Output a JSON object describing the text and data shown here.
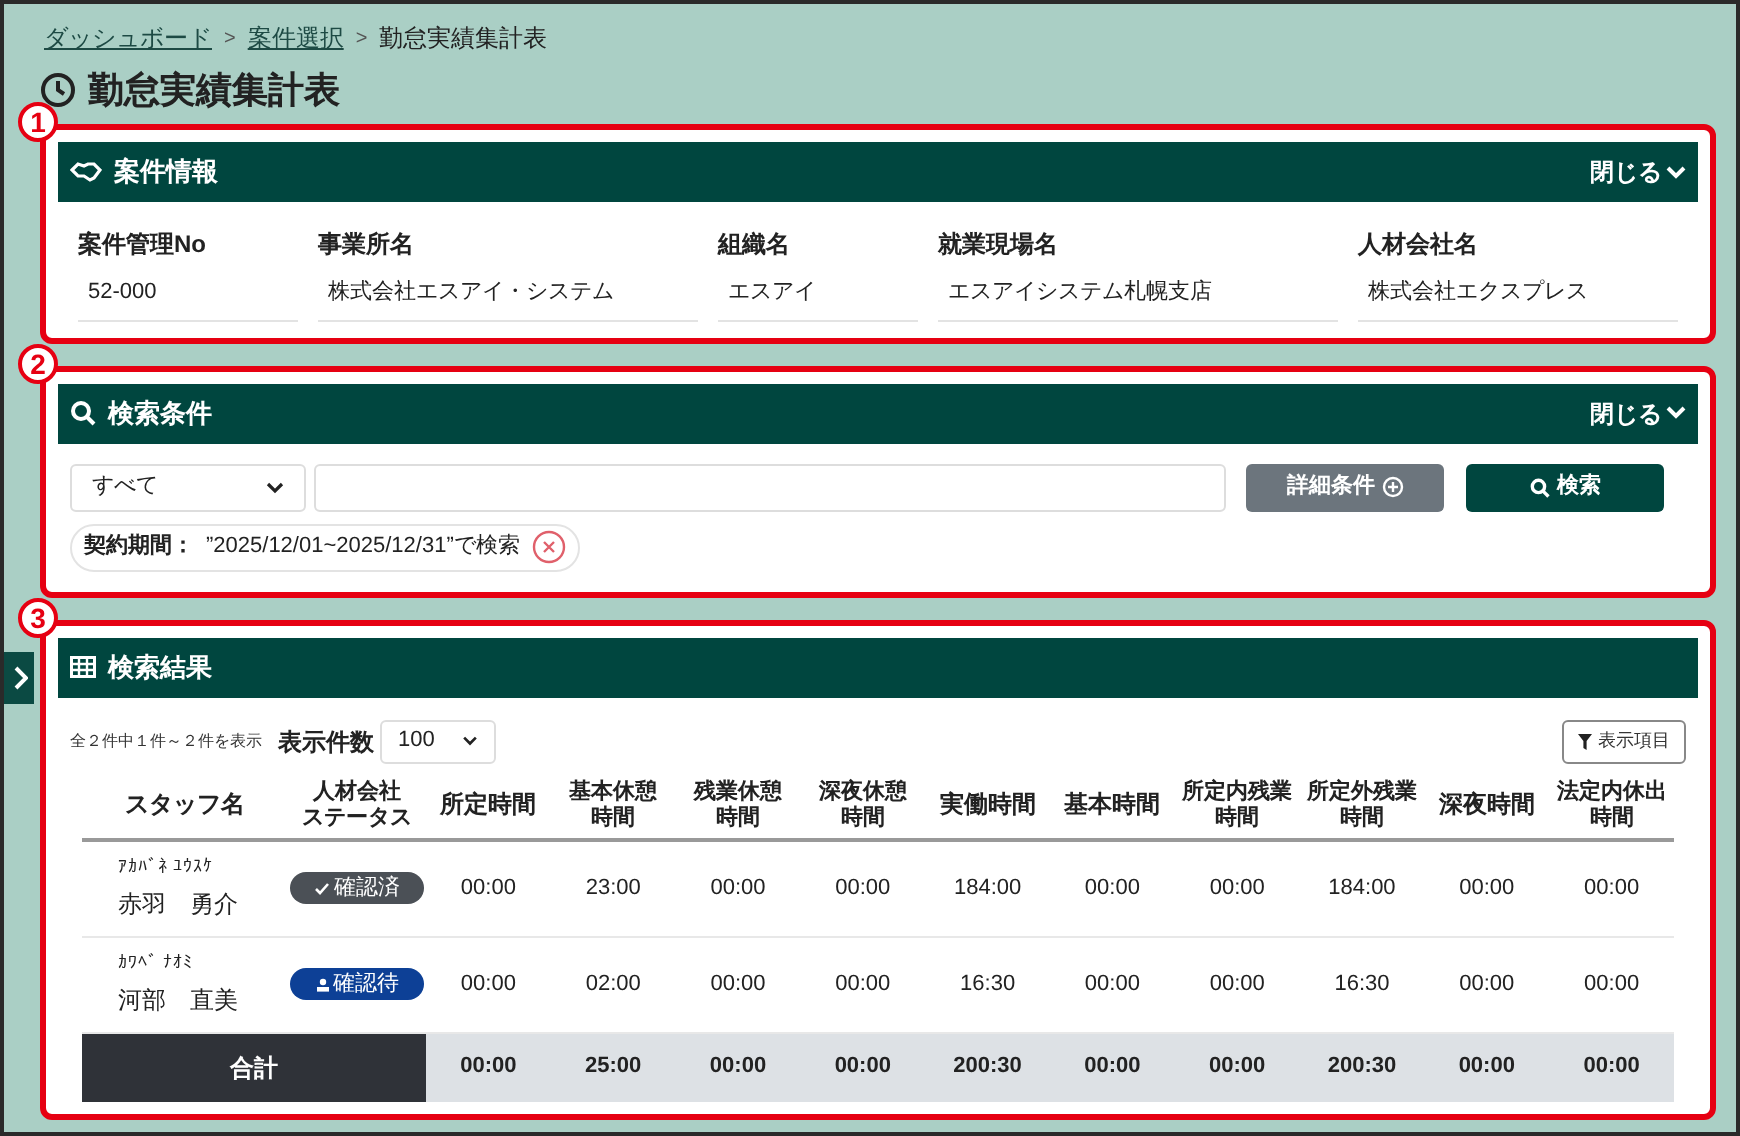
{
  "breadcrumb": [
    {
      "label": "ダッシュボード",
      "link": true
    },
    {
      "label": "案件選択",
      "link": true
    },
    {
      "label": "勤怠実績集計表",
      "link": false
    }
  ],
  "separator": ">",
  "page_title": "勤怠実績集計表",
  "sections": [
    {
      "number": "1",
      "title": "案件情報",
      "toggle": "閉じる"
    },
    {
      "number": "2",
      "title": "検索条件",
      "toggle": "閉じる"
    },
    {
      "number": "3",
      "title": "検索結果"
    }
  ],
  "project_info": [
    {
      "label": "案件管理No",
      "value": "52-000"
    },
    {
      "label": "事業所名",
      "value": "株式会社エスアイ・システム"
    },
    {
      "label": "組織名",
      "value": "エスアイ"
    },
    {
      "label": "就業現場名",
      "value": "エスアイシステム札幌支店"
    },
    {
      "label": "人材会社名",
      "value": "株式会社エクスプレス"
    }
  ],
  "search": {
    "filter_select": "すべて",
    "detail_button": "詳細条件",
    "search_button": "検索",
    "chip": {
      "label": "契約期間：",
      "value": "”2025/12/01~2025/12/31”で検索"
    }
  },
  "results": {
    "count_text": "全２件中１件～２件を表示",
    "page_size_label": "表示件数",
    "page_size": "100",
    "columns_button": "表示項目",
    "columns": [
      [
        "スタッフ名"
      ],
      [
        "人材会社",
        "ステータス"
      ],
      [
        "所定時間"
      ],
      [
        "基本休憩",
        "時間"
      ],
      [
        "残業休憩",
        "時間"
      ],
      [
        "深夜休憩",
        "時間"
      ],
      [
        "実働時間"
      ],
      [
        "基本時間"
      ],
      [
        "所定内残業",
        "時間"
      ],
      [
        "所定外残業",
        "時間"
      ],
      [
        "深夜時間"
      ],
      [
        "法定内休出",
        "時間"
      ]
    ],
    "rows": [
      {
        "kana": "ｱｶﾊﾞﾈ ﾕｳｽｹ",
        "name": "赤羽　勇介",
        "status": {
          "kind": "confirmed",
          "label": "確認済"
        },
        "values": [
          "00:00",
          "23:00",
          "00:00",
          "00:00",
          "184:00",
          "00:00",
          "00:00",
          "184:00",
          "00:00",
          "00:00"
        ]
      },
      {
        "kana": "ｶﾜﾍﾞ ﾅｵﾐ",
        "name": "河部　直美",
        "status": {
          "kind": "pending",
          "label": "確認待"
        },
        "values": [
          "00:00",
          "02:00",
          "00:00",
          "00:00",
          "16:30",
          "00:00",
          "00:00",
          "16:30",
          "00:00",
          "00:00"
        ]
      }
    ],
    "total": {
      "label": "合計",
      "values": [
        "00:00",
        "25:00",
        "00:00",
        "00:00",
        "200:30",
        "00:00",
        "00:00",
        "200:30",
        "00:00",
        "00:00"
      ]
    }
  }
}
